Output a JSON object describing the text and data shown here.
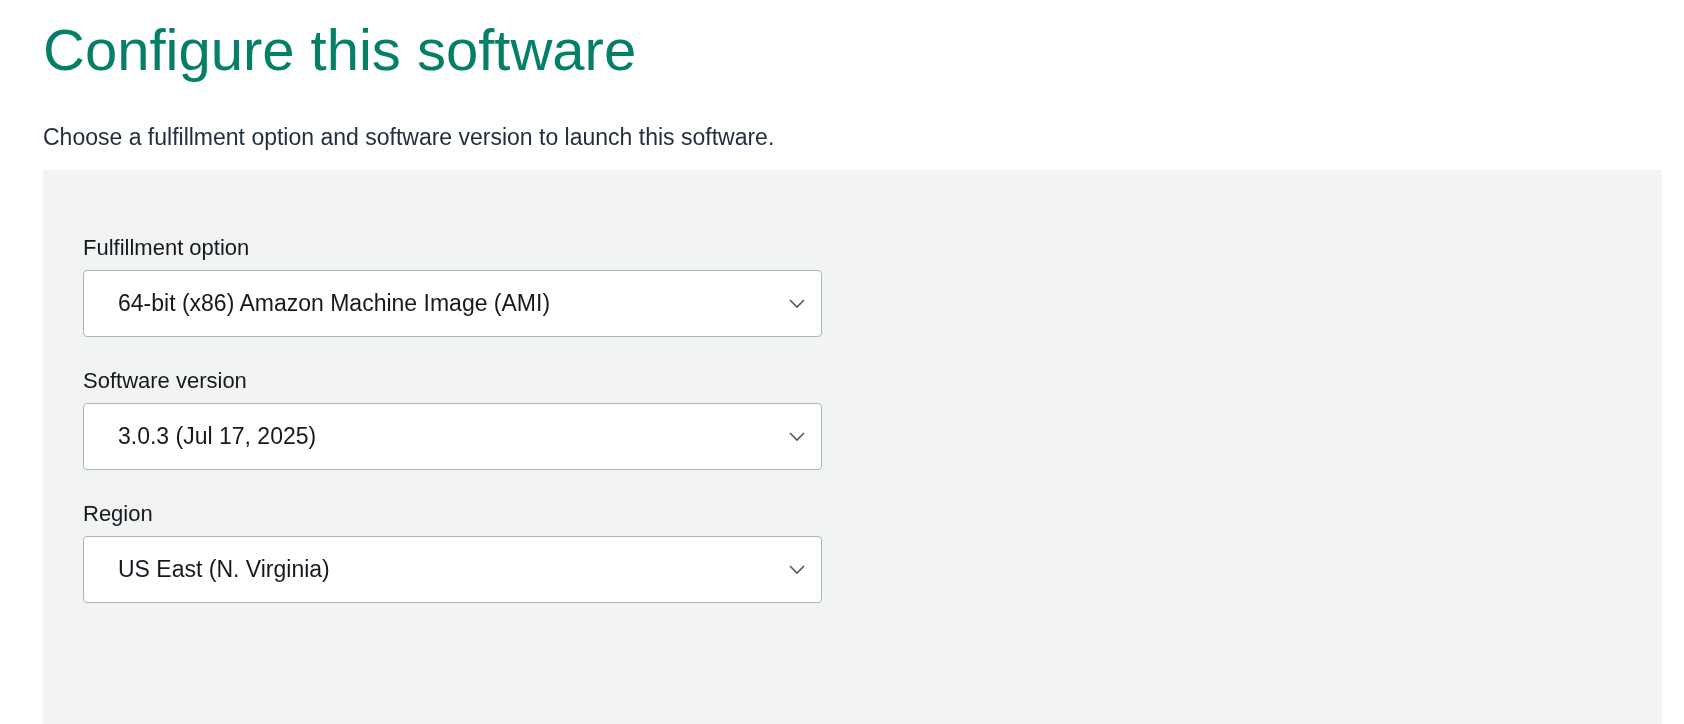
{
  "title": "Configure this software",
  "description": "Choose a fulfillment option and software version to launch this software.",
  "fields": [
    {
      "label": "Fulfillment option",
      "value": "64-bit (x86) Amazon Machine Image (AMI)"
    },
    {
      "label": "Software version",
      "value": "3.0.3 (Jul 17, 2025)"
    },
    {
      "label": "Region",
      "value": "US East (N. Virginia)"
    }
  ]
}
